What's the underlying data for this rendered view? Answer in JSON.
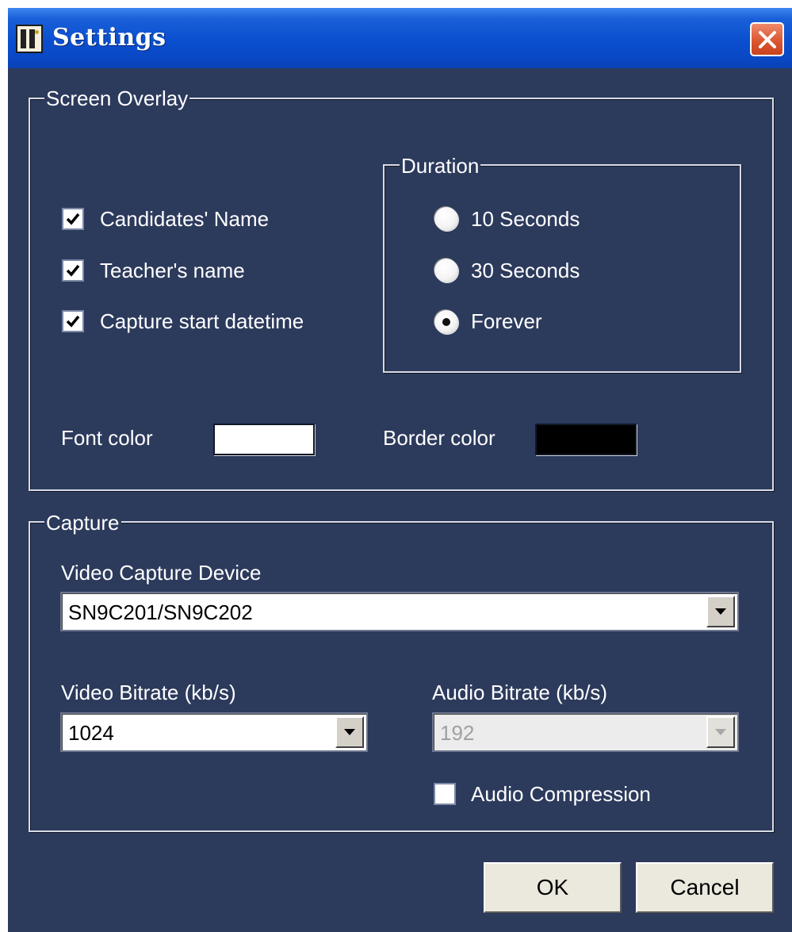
{
  "window": {
    "title": "Settings"
  },
  "screen_overlay": {
    "legend": "Screen Overlay",
    "checkboxes": [
      {
        "label": "Candidates' Name",
        "checked": true
      },
      {
        "label": "Teacher's name",
        "checked": true
      },
      {
        "label": "Capture start datetime",
        "checked": true
      }
    ],
    "duration": {
      "legend": "Duration",
      "options": [
        {
          "label": "10 Seconds",
          "selected": false
        },
        {
          "label": "30 Seconds",
          "selected": false
        },
        {
          "label": "Forever",
          "selected": true
        }
      ]
    },
    "font_color_label": "Font color",
    "font_color": "#ffffff",
    "border_color_label": "Border color",
    "border_color": "#000000"
  },
  "capture": {
    "legend": "Capture",
    "device_label": "Video Capture Device",
    "device_value": "SN9C201/SN9C202",
    "video_bitrate_label": "Video Bitrate (kb/s)",
    "video_bitrate_value": "1024",
    "audio_bitrate_label": "Audio Bitrate (kb/s)",
    "audio_bitrate_value": "192",
    "audio_compression_label": "Audio Compression",
    "audio_compression_checked": false
  },
  "buttons": {
    "ok": "OK",
    "cancel": "Cancel"
  },
  "colors": {
    "dialog_bg": "#2c3a5c",
    "titlebar": "#0a4fcf",
    "close": "#d9532e"
  }
}
